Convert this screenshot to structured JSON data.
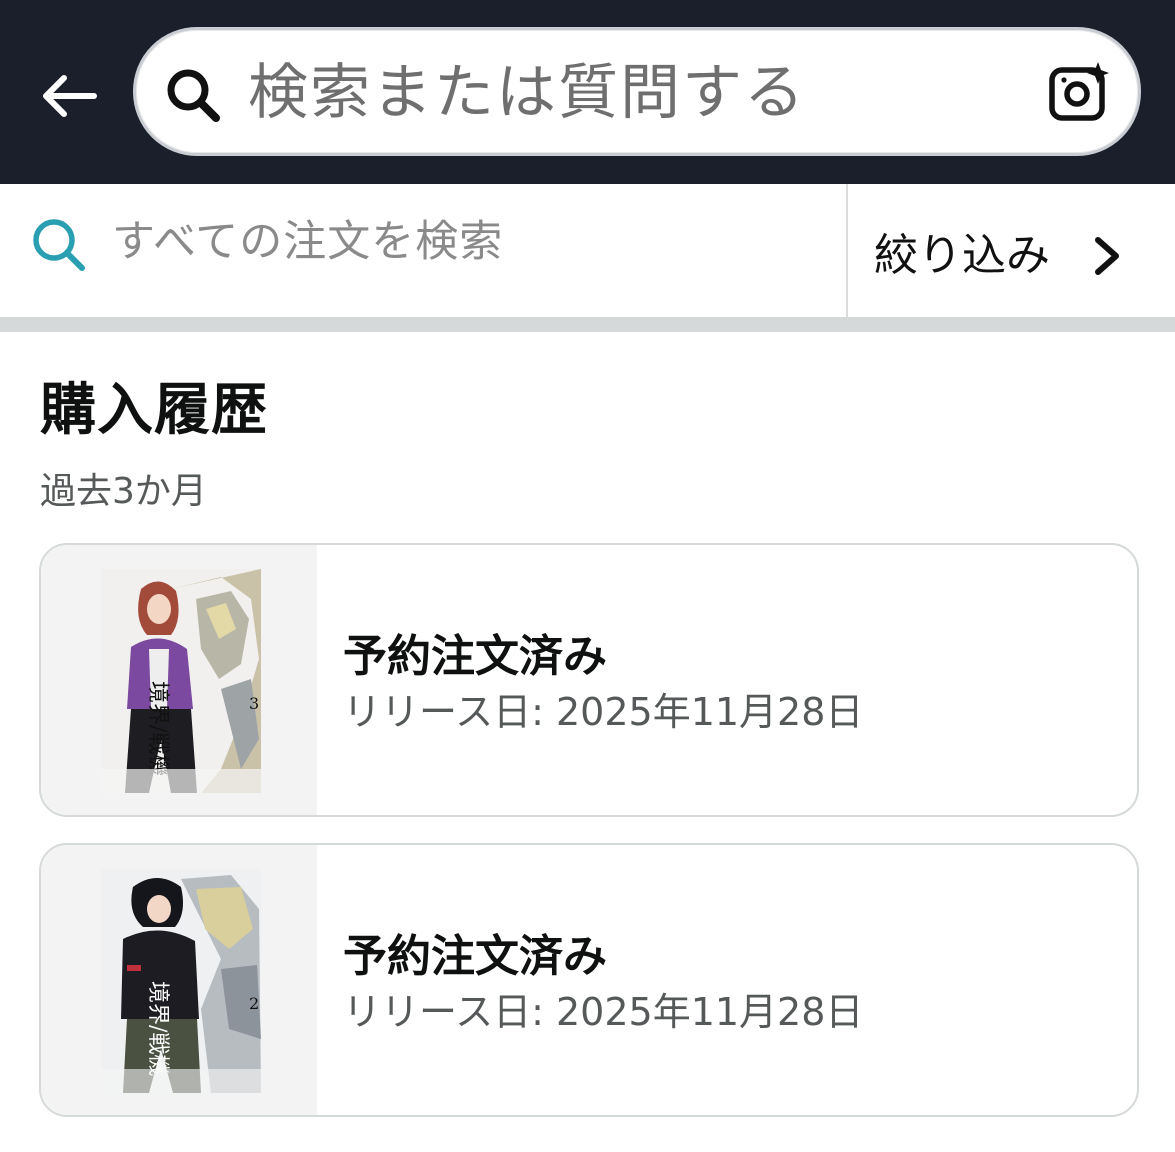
{
  "header": {
    "search_placeholder": "検索または質問する",
    "back_icon": "back-arrow-icon",
    "search_icon": "search-icon",
    "camera_icon": "camera-sparkle-icon"
  },
  "order_search": {
    "placeholder": "すべての注文を検索",
    "filter_label": "絞り込み",
    "accent_color": "#2a9fb1"
  },
  "page": {
    "title": "購入履歴",
    "period": "過去3か月"
  },
  "orders": [
    {
      "status": "予約注文済み",
      "release_label": "リリース日: ",
      "release_date": "2025年11月28日",
      "cover": {
        "title_text": "境界/戦機",
        "volume": "3"
      }
    },
    {
      "status": "予約注文済み",
      "release_label": "リリース日: ",
      "release_date": "2025年11月28日",
      "cover": {
        "title_text": "境界/戦機",
        "volume": "2"
      }
    }
  ]
}
